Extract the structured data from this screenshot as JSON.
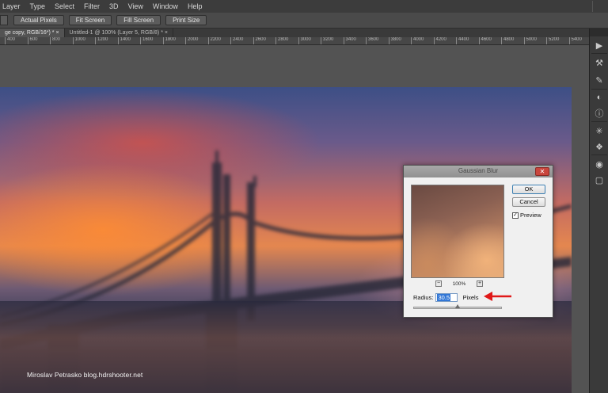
{
  "menubar": {
    "items": [
      "Layer",
      "Type",
      "Select",
      "Filter",
      "3D",
      "View",
      "Window",
      "Help"
    ]
  },
  "options_bar": {
    "buttons": [
      "Actual Pixels",
      "Fit Screen",
      "Fill Screen",
      "Print Size"
    ]
  },
  "tabs": [
    {
      "label": "ge copy, RGB/16*) *  ×",
      "active": true
    },
    {
      "label": "Untitled-1 @ 100% (Layer 5, RGB/8) *  ×",
      "active": false
    }
  ],
  "ruler": {
    "ticks": [
      "400",
      "600",
      "800",
      "1000",
      "1200",
      "1400",
      "1600",
      "1800",
      "2000",
      "2200",
      "2400",
      "2600",
      "2800",
      "3000",
      "3200",
      "3400",
      "3600",
      "3800",
      "4000",
      "4200",
      "4400",
      "4600",
      "4800",
      "5000",
      "5200",
      "5400"
    ]
  },
  "photo": {
    "credit": "Miroslav  Petrasko  blog.hdrshooter.net"
  },
  "dialog": {
    "title": "Gaussian Blur",
    "close_label": "✕",
    "ok_label": "OK",
    "cancel_label": "Cancel",
    "preview_label": "Preview",
    "preview_checked": true,
    "check_mark": "✓",
    "zoom_out": "−",
    "zoom_in": "+",
    "zoom_level": "100%",
    "radius_label": "Radius:",
    "radius_value": "30.5",
    "units": "Pixels",
    "slider_position": 0.5
  },
  "colors": {
    "annotation_arrow": "#e01818",
    "close_button": "#c9463d"
  },
  "panel_icons": [
    "play-icon",
    "tools-icon",
    "brush-icon",
    "adjust-icon",
    "info-icon",
    "asterisk-icon",
    "layers-icon",
    "channels-icon",
    "paths-icon"
  ]
}
